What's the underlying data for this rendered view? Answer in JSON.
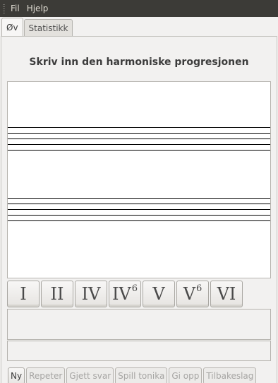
{
  "menubar": {
    "items": [
      {
        "label": "Fil"
      },
      {
        "label": "Hjelp"
      }
    ]
  },
  "tabs": [
    {
      "label": "Øv",
      "active": true
    },
    {
      "label": "Statistikk",
      "active": false
    }
  ],
  "exercise": {
    "heading": "Skriv inn den harmoniske progresjonen"
  },
  "chords": [
    {
      "label": "I",
      "sup": ""
    },
    {
      "label": "II",
      "sup": ""
    },
    {
      "label": "IV",
      "sup": ""
    },
    {
      "label": "IV",
      "sup": "6"
    },
    {
      "label": "V",
      "sup": ""
    },
    {
      "label": "V",
      "sup": "6"
    },
    {
      "label": "VI",
      "sup": ""
    }
  ],
  "actions": [
    {
      "label": "Ny",
      "enabled": true
    },
    {
      "label": "Repeter",
      "enabled": false
    },
    {
      "label": "Gjett svar",
      "enabled": false
    },
    {
      "label": "Spill tonika",
      "enabled": false
    },
    {
      "label": "Gi opp",
      "enabled": false
    },
    {
      "label": "Tilbakeslag",
      "enabled": false
    }
  ]
}
